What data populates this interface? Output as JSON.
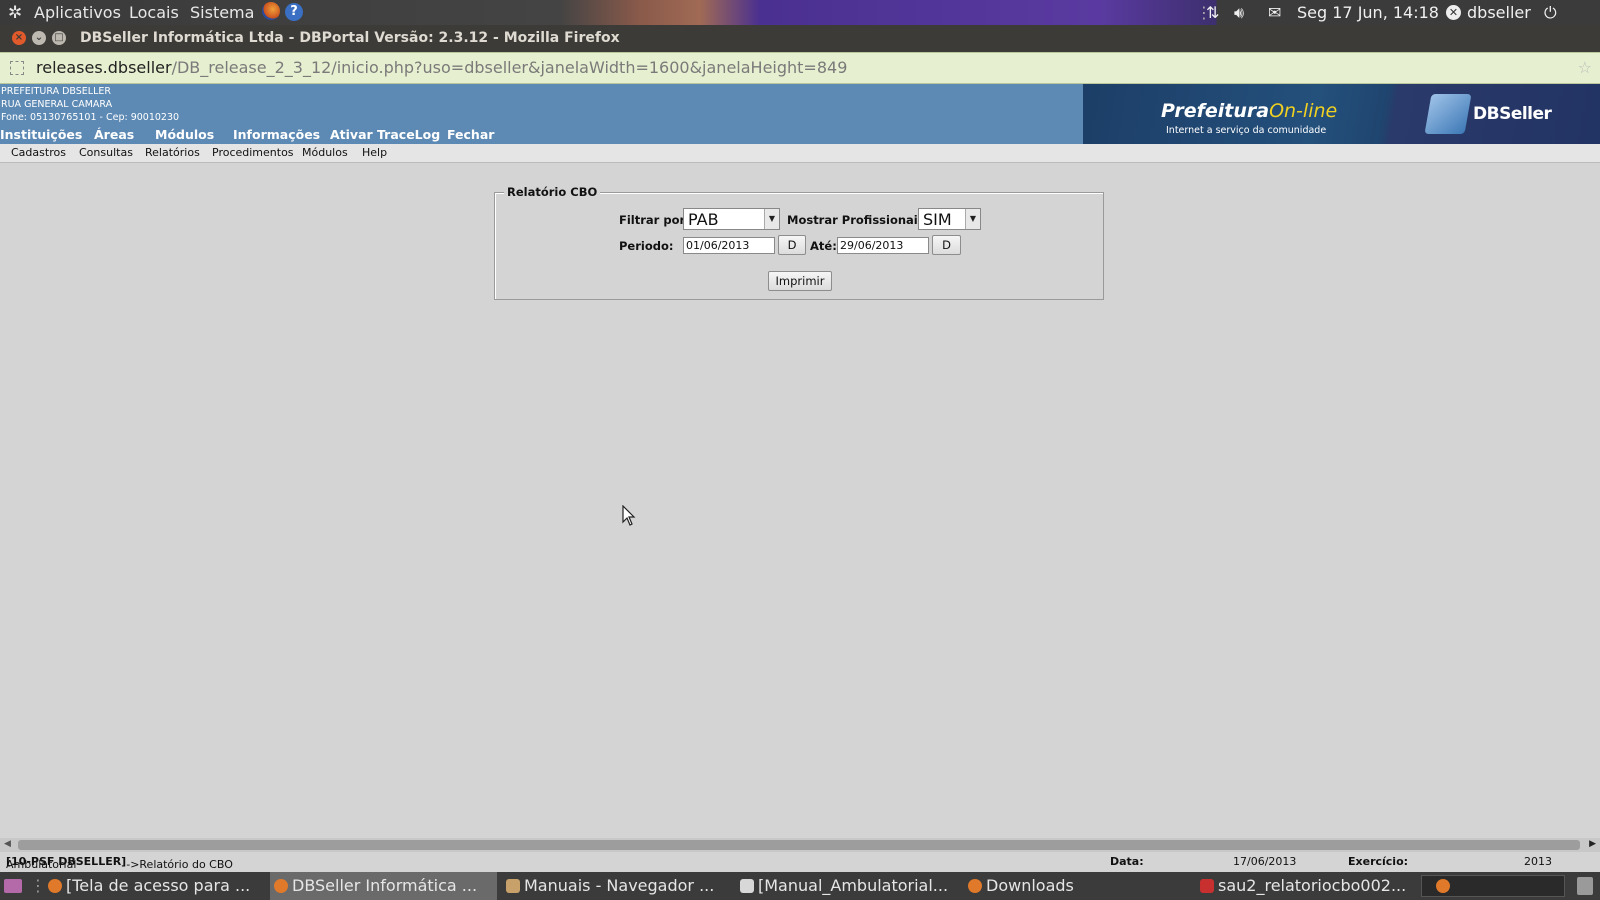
{
  "top_panel": {
    "menus": [
      "Aplicativos",
      "Locais",
      "Sistema"
    ],
    "datetime": "Seg 17 Jun, 14:18",
    "user": "dbseller"
  },
  "window": {
    "title": "DBSeller Informática Ltda - DBPortal Versão: 2.3.12 - Mozilla Firefox"
  },
  "url": {
    "host": "releases.dbseller",
    "path": "/DB_release_2_3_12/inicio.php?uso=dbseller&janelaWidth=1600&janelaHeight=849"
  },
  "header": {
    "org_lines": [
      "PREFEITURA DBSELLER",
      "RUA GENERAL CAMARA",
      "Fone: 05130765101  -  Cep: 90010230"
    ],
    "main_menu": [
      "Instituições",
      "Áreas",
      "Módulos",
      "Informações",
      "Ativar TraceLog",
      "Fechar"
    ],
    "banner_title_1": "Prefeitura",
    "banner_title_2": "On-line",
    "banner_tagline": "Internet a serviço da comunidade",
    "banner_logo": "DBSeller"
  },
  "submenu": [
    "Cadastros",
    "Consultas",
    "Relatórios",
    "Procedimentos",
    "Módulos",
    "Help"
  ],
  "form": {
    "legend": "Relatório CBO",
    "filter_label": "Filtrar por:",
    "filter_value": "PAB",
    "show_prof_label": "Mostrar Profissionais:",
    "show_prof_value": "SIM",
    "period_label": "Periodo:",
    "date_from": "01/06/2013",
    "date_button": "D",
    "to_label": "Até:",
    "date_to": "29/06/2013",
    "print_button": "Imprimir"
  },
  "statusbar": {
    "path_prefix": "Ambulatorial",
    "path_bold": "[10-PSF DBSELLER]",
    "path_suffix": "->Relatório do CBO",
    "date_label": "Data:",
    "date_value": "17/06/2013",
    "exercicio_label": "Exercício:",
    "exercicio_value": "2013"
  },
  "taskbar": [
    "[Tela de acesso para ...",
    "DBSeller Informática ...",
    "Manuais - Navegador ...",
    "[Manual_Ambulatorial...",
    "Downloads",
    "sau2_relatoriocbo002..."
  ],
  "colors": {
    "header_blue": "#5d8ab4",
    "banner_dark": "#1c3e67",
    "banner_accent": "#f0d020",
    "page_bg": "#d4d4d4"
  }
}
